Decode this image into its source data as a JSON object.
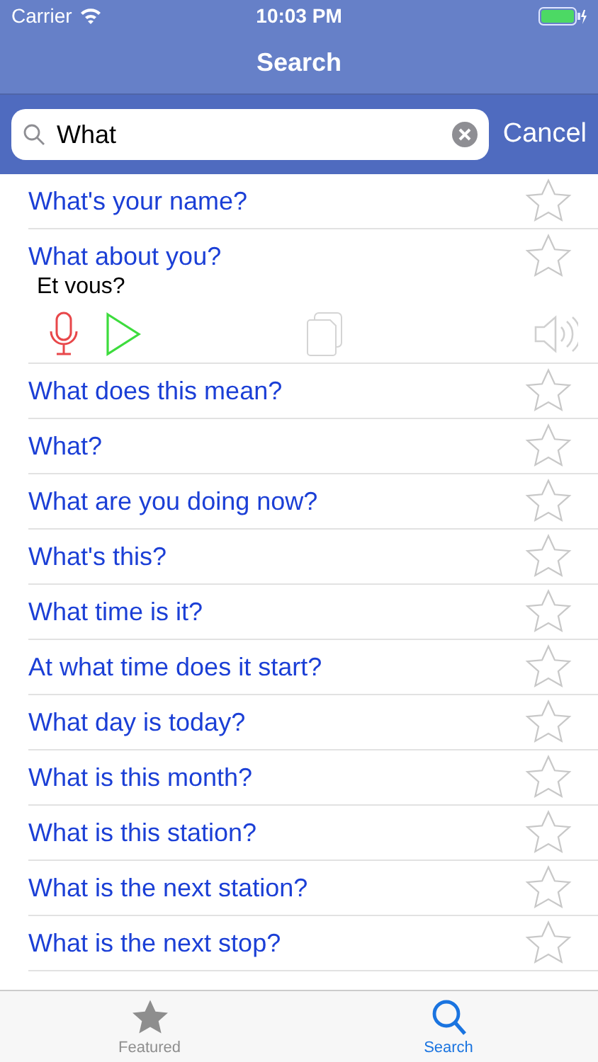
{
  "status_bar": {
    "carrier": "Carrier",
    "time": "10:03 PM"
  },
  "nav": {
    "title": "Search"
  },
  "search": {
    "value": "What",
    "cancel": "Cancel"
  },
  "results": [
    {
      "text": "What's your name?",
      "starred": false,
      "expanded": false
    },
    {
      "text": "What about you?",
      "starred": false,
      "expanded": true,
      "translation": "Et vous?"
    },
    {
      "text": "What does this mean?",
      "starred": false,
      "expanded": false
    },
    {
      "text": "What?",
      "starred": false,
      "expanded": false
    },
    {
      "text": "What are you doing now?",
      "starred": false,
      "expanded": false
    },
    {
      "text": "What's this?",
      "starred": false,
      "expanded": false
    },
    {
      "text": "What time is it?",
      "starred": false,
      "expanded": false
    },
    {
      "text": "At what time does it start?",
      "starred": false,
      "expanded": false
    },
    {
      "text": "What day is today?",
      "starred": false,
      "expanded": false
    },
    {
      "text": "What is this month?",
      "starred": false,
      "expanded": false
    },
    {
      "text": "What is this station?",
      "starred": false,
      "expanded": false
    },
    {
      "text": "What is the next station?",
      "starred": false,
      "expanded": false
    },
    {
      "text": "What is the next stop?",
      "starred": false,
      "expanded": false
    }
  ],
  "tabs": [
    {
      "label": "Featured",
      "kind": "star",
      "selected": false
    },
    {
      "label": "Search",
      "kind": "search",
      "selected": true
    }
  ]
}
